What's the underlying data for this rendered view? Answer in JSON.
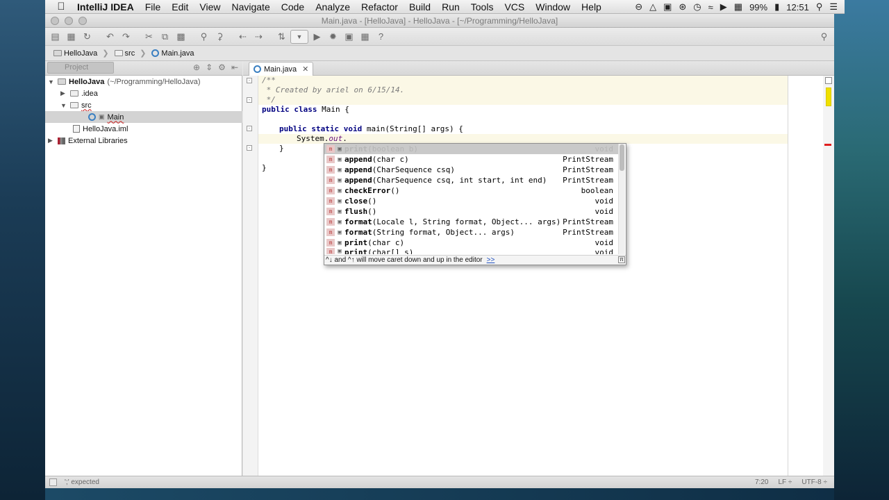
{
  "menubar": {
    "app_name": "IntelliJ IDEA",
    "items": [
      "File",
      "Edit",
      "View",
      "Navigate",
      "Code",
      "Analyze",
      "Refactor",
      "Build",
      "Run",
      "Tools",
      "VCS",
      "Window",
      "Help"
    ],
    "battery": "99%",
    "clock": "12:51"
  },
  "window": {
    "title": "Main.java - [HelloJava] - HelloJava - [~/Programming/HelloJava]"
  },
  "navbar": {
    "crumbs": [
      "HelloJava",
      "src",
      "Main.java"
    ]
  },
  "project_panel": {
    "tab_label": "Project",
    "tree": {
      "root_name": "HelloJava",
      "root_path": "(~/Programming/HelloJava)",
      "idea": ".idea",
      "src": "src",
      "main": "Main",
      "iml": "HelloJava.iml",
      "libs": "External Libraries"
    }
  },
  "editor": {
    "tab_label": "Main.java",
    "code": {
      "l1": "/**",
      "l2": " * Created by ariel on 6/15/14.",
      "l3": " */",
      "l4_kw": "public class",
      "l4_rest": " Main {",
      "l6_kw": "public static void",
      "l6_rest": " main(String[] args) {",
      "l7_sys": "System.",
      "l7_out": "out",
      "l7_dot": ".",
      "l8": "}",
      "l10": "}"
    }
  },
  "completion": {
    "items": [
      {
        "name": "print",
        "params": "(boolean b)",
        "ret": "void"
      },
      {
        "name": "append",
        "params": "(char c)",
        "ret": "PrintStream"
      },
      {
        "name": "append",
        "params": "(CharSequence csq)",
        "ret": "PrintStream"
      },
      {
        "name": "append",
        "params": "(CharSequence csq, int start, int end)",
        "ret": "PrintStream"
      },
      {
        "name": "checkError",
        "params": "()",
        "ret": "boolean"
      },
      {
        "name": "close",
        "params": "()",
        "ret": "void"
      },
      {
        "name": "flush",
        "params": "()",
        "ret": "void"
      },
      {
        "name": "format",
        "params": "(Locale l, String format, Object... args)",
        "ret": "PrintStream"
      },
      {
        "name": "format",
        "params": "(String format, Object... args)",
        "ret": "PrintStream"
      },
      {
        "name": "print",
        "params": "(char c)",
        "ret": "void"
      },
      {
        "name": "print",
        "params": "(char[] s)",
        "ret": "void"
      }
    ],
    "hint": "^↓ and ^↑ will move caret down and up in the editor",
    "hint_link": ">>"
  },
  "statusbar": {
    "message": "';' expected",
    "position": "7:20",
    "line_sep": "LF ÷",
    "encoding": "UTF-8 ÷"
  }
}
